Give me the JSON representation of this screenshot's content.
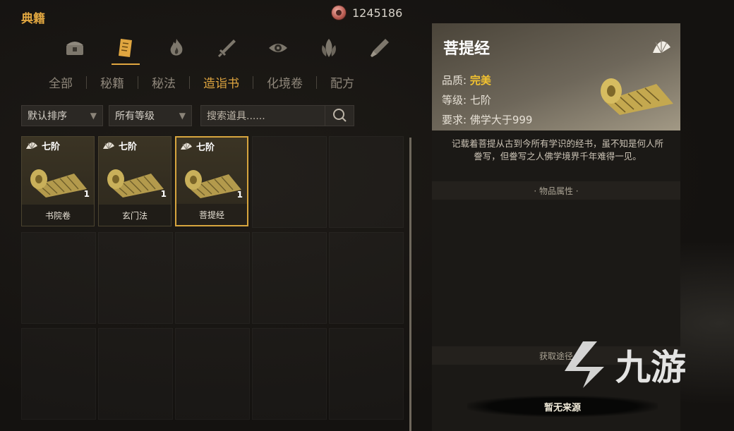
{
  "header": {
    "title": "典籍",
    "currency_value": "1245186"
  },
  "category_icons": [
    "chest-icon",
    "book-icon",
    "flame-icon",
    "sword-icon",
    "eye-icon",
    "leaf-icon",
    "brush-icon"
  ],
  "tabs": [
    {
      "label": "全部",
      "active": false
    },
    {
      "label": "秘籍",
      "active": false
    },
    {
      "label": "秘法",
      "active": false
    },
    {
      "label": "造诣书",
      "active": true
    },
    {
      "label": "化境卷",
      "active": false
    },
    {
      "label": "配方",
      "active": false
    }
  ],
  "filters": {
    "sort": "默认排序",
    "grade": "所有等级",
    "search_placeholder": "搜索道具......"
  },
  "items": [
    {
      "tier": "七阶",
      "qty": "1",
      "name": "书院卷",
      "selected": false
    },
    {
      "tier": "七阶",
      "qty": "1",
      "name": "玄门法",
      "selected": false
    },
    {
      "tier": "七阶",
      "qty": "1",
      "name": "菩提经",
      "selected": true
    }
  ],
  "detail": {
    "title": "菩提经",
    "quality_label": "品质:",
    "quality_value": "完美",
    "level_label": "等级:",
    "level_value": "七阶",
    "requirement_label": "要求:",
    "requirement_value": "佛学大于999",
    "description": "记载着菩提从古到今所有学识的经书，虽不知是何人所誊写，但誊写之人佛学境界千年难得一见。",
    "section_attributes": "· 物品属性 ·",
    "section_source": "获取途径",
    "source_value": "暂无来源"
  },
  "watermark": {
    "text": "九游"
  },
  "colors": {
    "accent": "#e0a640",
    "quality_gold": "#f2c230"
  }
}
